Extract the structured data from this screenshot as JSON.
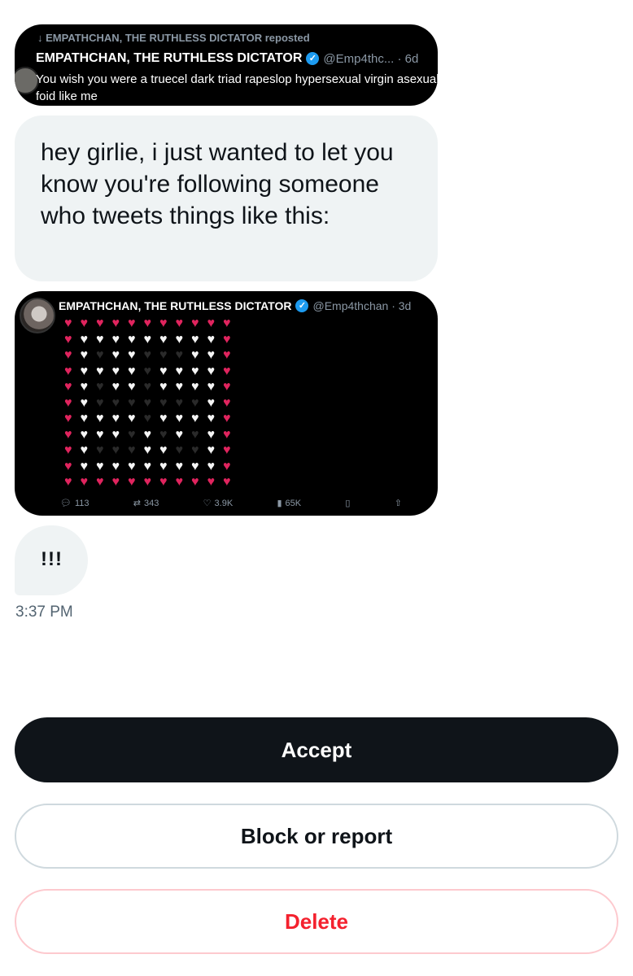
{
  "repost_tweet": {
    "repost_label": "↓ EMPATHCHAN, THE RUTHLESS DICTATOR reposted",
    "author": "EMPATHCHAN, THE RUTHLESS DICTATOR",
    "handle": "@Emp4thc... · 6d",
    "text": "You wish you were a truecel dark triad rapeslop hypersexual virgin asexual foid like me"
  },
  "message": {
    "text": "hey girlie, i just wanted to let you know you're following someone who tweets things like this:"
  },
  "shared_tweet": {
    "author": "EMPATHCHAN, THE RUTHLESS DICTATOR",
    "handle": "@Emp4thchan · 3d",
    "hearts_rows": [
      "rrrrrrrrrrr",
      "rwwwwwwwwwr",
      "rwbwwbbbwwr",
      "rwwwwbwwwwr",
      "rwbwwbwwwwr",
      "rwbbbbbbbwr",
      "rwwwwbwwwwr",
      "rwwwbwbwbwr",
      "rwbbbwwbbwr",
      "rwwwwwwwwwr",
      "rrrrrrrrrrr"
    ],
    "stats": {
      "replies": "113",
      "reposts": "343",
      "likes": "3.9K",
      "views": "65K"
    }
  },
  "followup": {
    "text": "!!!"
  },
  "timestamp": "3:37 PM",
  "buttons": {
    "accept": "Accept",
    "block": "Block or report",
    "delete": "Delete"
  },
  "colors": {
    "accept_bg": "#0f1419",
    "delete_text": "#f4212e",
    "bubble_bg": "#eff3f4",
    "verified": "#1d9bf0"
  }
}
